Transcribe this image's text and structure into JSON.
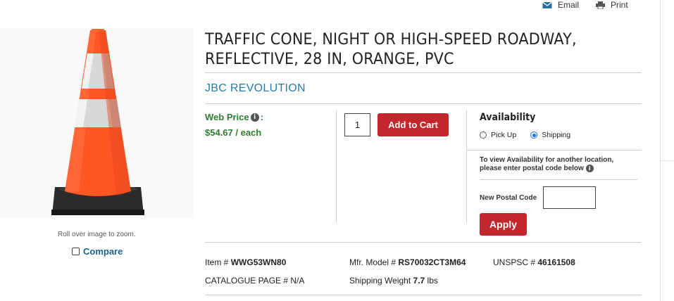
{
  "header": {
    "links": [
      {
        "label": "Email",
        "icon": "envelope-icon"
      },
      {
        "label": "Print",
        "icon": "printer-icon"
      }
    ]
  },
  "gallery": {
    "zoom_hint": "Roll over image to zoom.",
    "compare_label": "Compare",
    "product_image": "orange-traffic-cone-with-reflective-bands"
  },
  "product": {
    "title": "TRAFFIC CONE, NIGHT OR HIGH-SPEED ROADWAY, REFLECTIVE, 28 IN, ORANGE, PVC",
    "brand": "JBC REVOLUTION",
    "price_label": "Web Price",
    "price_suffix": ":",
    "price_value": "$54.67 / each"
  },
  "cart": {
    "quantity": "1",
    "add_label": "Add to Cart"
  },
  "availability": {
    "title": "Availability",
    "options": [
      {
        "label": "Pick Up",
        "selected": false
      },
      {
        "label": "Shipping",
        "selected": true
      }
    ],
    "note": "To view Availability for another location, please enter postal code below",
    "postal_label": "New Postal Code",
    "postal_value": "",
    "apply_label": "Apply"
  },
  "specs": {
    "item_label": "Item #",
    "item_value": "WWG53WN80",
    "mfr_label": "Mfr. Model #",
    "mfr_value": "RS70032CT3M64",
    "unspsc_label": "UNSPSC #",
    "unspsc_value": "46161508",
    "catalogue_label": "CATALOGUE PAGE #",
    "catalogue_value": "N/A",
    "weight_label": "Shipping Weight",
    "weight_value": "7.7",
    "weight_unit": "lbs"
  },
  "colors": {
    "brand_blue": "#2a7aa8",
    "price_green": "#2e7d32",
    "button_red": "#c1272d",
    "cone_orange": "#ff5722"
  }
}
